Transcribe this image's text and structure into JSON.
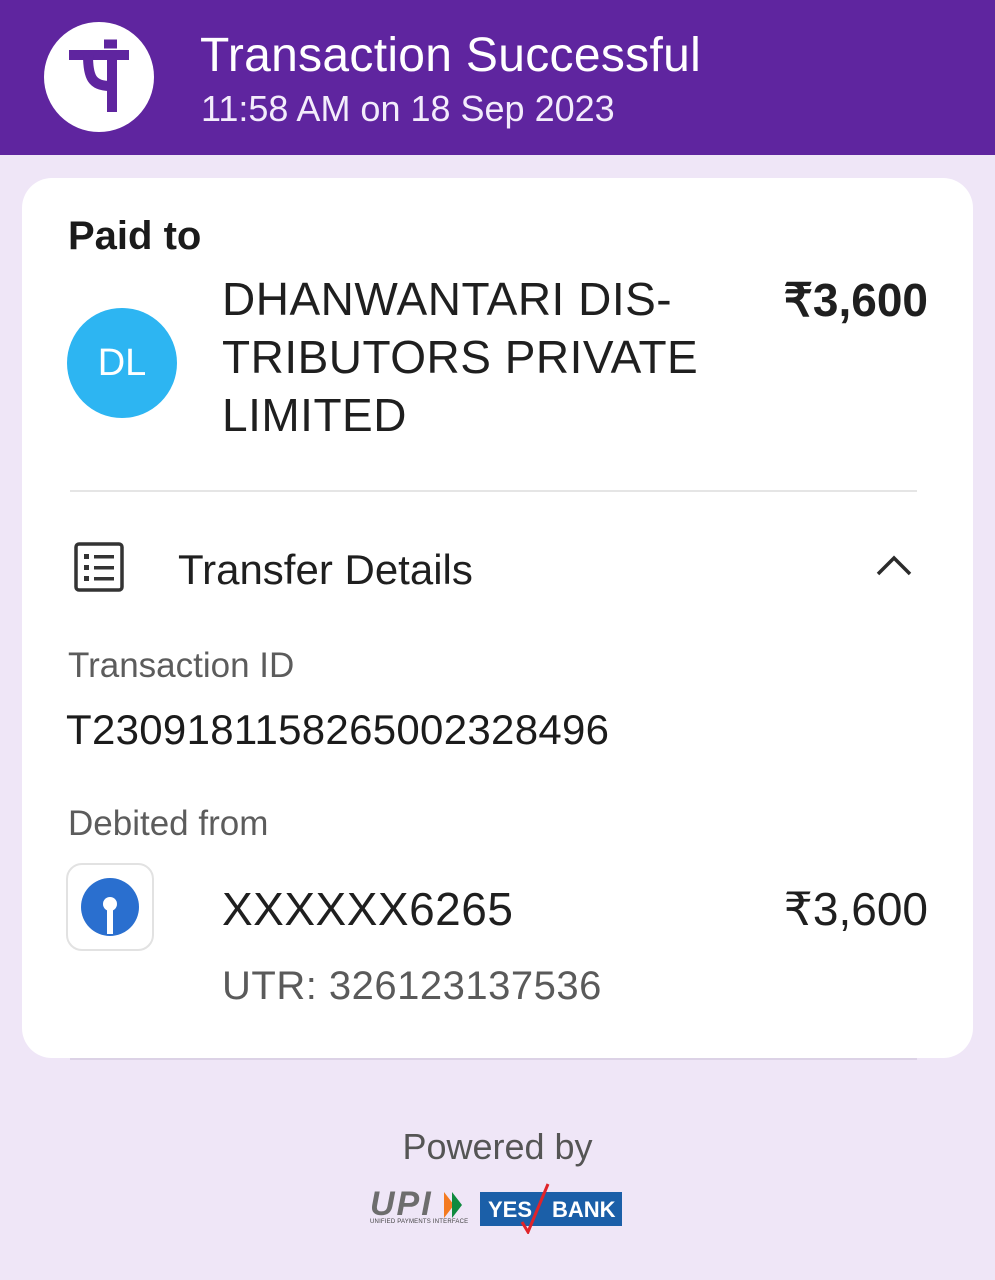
{
  "header": {
    "title": "Transaction Successful",
    "datetime": "11:58 AM on 18 Sep 2023",
    "logo_icon": "phonepe-logo-icon",
    "background_color": "#5f259f"
  },
  "payee": {
    "section_label": "Paid to",
    "avatar_initials": "DL",
    "avatar_color": "#2db5f2",
    "name": "DHANWANTARI DIS-TRIBUTORS PRIVATE LIMITED",
    "amount": "₹3,600"
  },
  "transfer_details": {
    "title": "Transfer Details",
    "icon": "receipt-list-icon",
    "expand_icon": "chevron-up-icon",
    "transaction_id_label": "Transaction ID",
    "transaction_id": "T2309181158265002328496",
    "debited_from_label": "Debited from",
    "bank_icon": "sbi-logo-icon",
    "account": "XXXXXX6265",
    "amount": "₹3,600",
    "utr": "UTR: 326123137536"
  },
  "footer": {
    "powered_by": "Powered by",
    "upi_logo_text": "UPI",
    "upi_subtitle": "UNIFIED PAYMENTS INTERFACE",
    "bank_logo_yes": "YES",
    "bank_logo_bank": "BANK"
  }
}
